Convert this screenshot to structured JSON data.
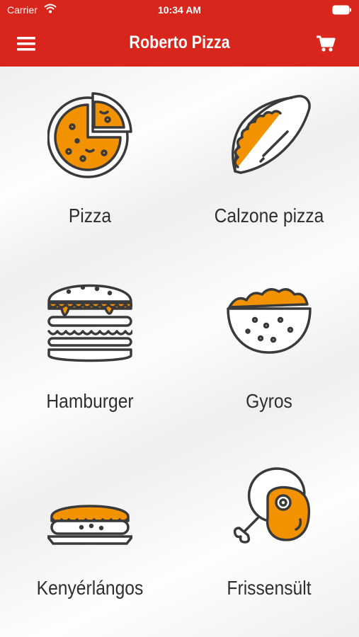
{
  "status_bar": {
    "carrier": "Carrier",
    "time": "10:34 AM"
  },
  "header": {
    "title": "Roberto Pizza",
    "menu_icon": "hamburger-menu-icon",
    "cart_icon": "shopping-cart-icon"
  },
  "colors": {
    "header": "#d8261d",
    "accent": "#f39200",
    "outline": "#3a3a3a"
  },
  "categories": [
    {
      "label": "Pizza",
      "icon": "pizza-icon"
    },
    {
      "label": "Calzone pizza",
      "icon": "calzone-icon"
    },
    {
      "label": "Hamburger",
      "icon": "hamburger-icon"
    },
    {
      "label": "Gyros",
      "icon": "gyros-bowl-icon"
    },
    {
      "label": "Kenyérlángos",
      "icon": "flatbread-icon"
    },
    {
      "label": "Frissensült",
      "icon": "drumstick-steak-icon"
    }
  ]
}
